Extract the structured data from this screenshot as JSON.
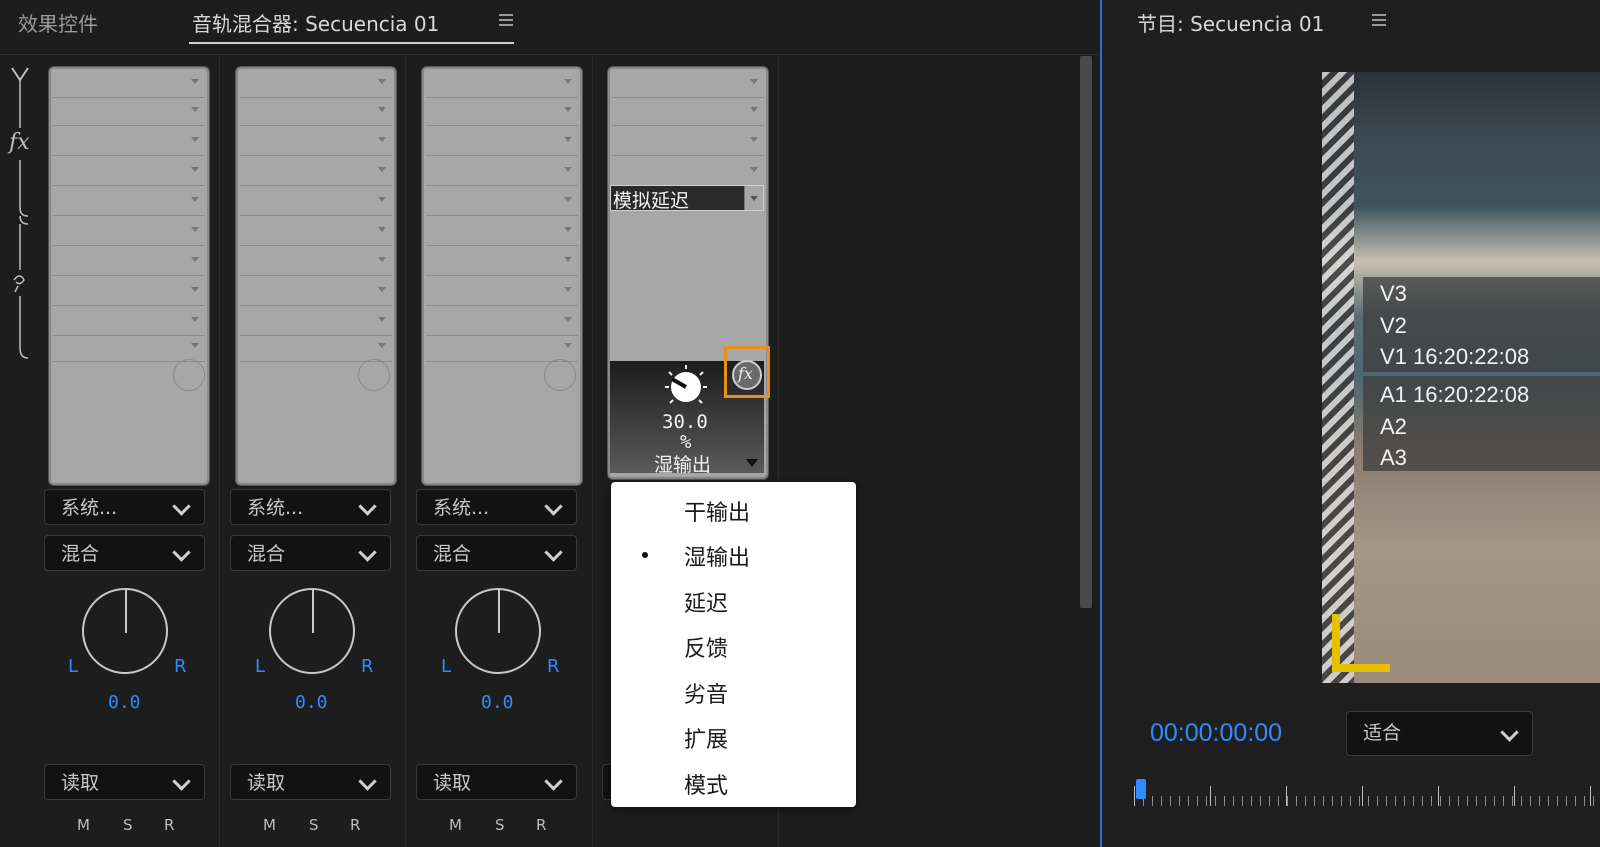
{
  "tabs": {
    "effects": "效果控件",
    "mixer": "音轨混合器: Secuencia 01",
    "program": "节目: Secuencia 01"
  },
  "side_strip": {
    "fx_label": "fx"
  },
  "tracks": [
    {
      "output": "系统...",
      "mode": "混合",
      "pan_left": "L",
      "pan_right": "R",
      "pan_value": "0.0",
      "automation": "读取",
      "m": "M",
      "s": "S",
      "r": "R"
    },
    {
      "output": "系统...",
      "mode": "混合",
      "pan_left": "L",
      "pan_right": "R",
      "pan_value": "0.0",
      "automation": "读取",
      "m": "M",
      "s": "S",
      "r": "R"
    },
    {
      "output": "系统...",
      "mode": "混合",
      "pan_left": "L",
      "pan_right": "R",
      "pan_value": "0.0",
      "automation": "读取",
      "m": "M",
      "s": "S",
      "r": "R"
    }
  ],
  "effect_rack": {
    "effect_name": "模拟延迟",
    "param_value": "30.0",
    "param_unit": "%",
    "param_name": "湿输出",
    "fx_button": "fx"
  },
  "param_menu": {
    "items": [
      "干输出",
      "湿输出",
      "延迟",
      "反馈",
      "劣音",
      "扩展",
      "模式"
    ],
    "selected": "湿输出"
  },
  "program_monitor": {
    "tracks": [
      "V3",
      "V2",
      "V1 16:20:22:08",
      "A1 16:20:22:08",
      "A2",
      "A3"
    ],
    "timecode": "00:00:00:00",
    "zoom": "适合"
  },
  "colors": {
    "accent_blue": "#2f8bff",
    "highlight_orange": "#e8901e",
    "corner_yellow": "#e6c000"
  }
}
